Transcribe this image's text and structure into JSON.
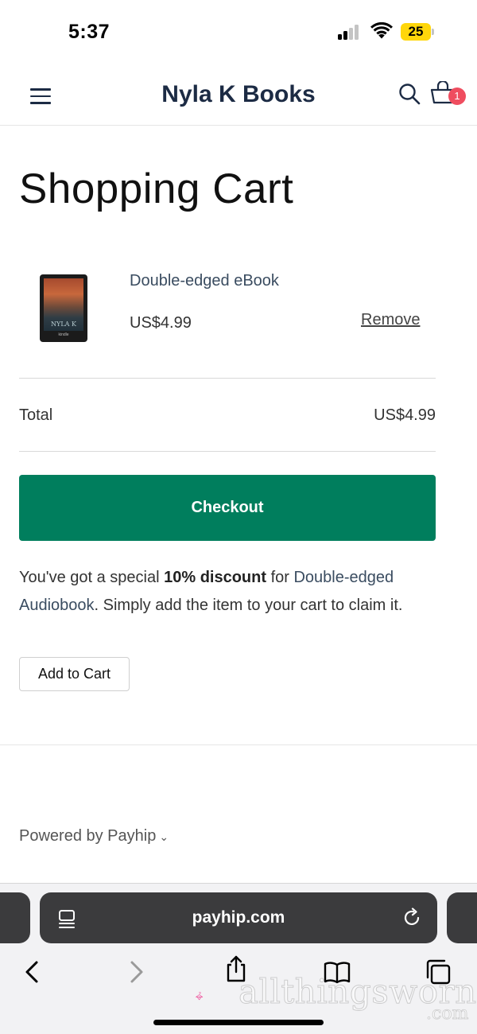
{
  "status_bar": {
    "time": "5:37",
    "battery_level": "25",
    "battery_color": "#ffd60a"
  },
  "header": {
    "site_title": "Nyla K Books",
    "cart_count": "1",
    "menu_icon": "hamburger-menu-icon",
    "search_icon": "search-icon",
    "cart_icon": "shopping-basket-icon",
    "brand_color": "#1c2b44"
  },
  "page": {
    "title": "Shopping Cart"
  },
  "cart": {
    "items": [
      {
        "name": "Double-edged eBook",
        "price": "US$4.99",
        "remove_label": "Remove",
        "thumb_caption": "NYLA K",
        "thumb_device_label": "kindle"
      }
    ],
    "total_label": "Total",
    "total_value": "US$4.99",
    "checkout_label": "Checkout",
    "checkout_color": "#007e5d"
  },
  "promo": {
    "prefix": "You've got a special ",
    "discount": "10% discount",
    "middle": " for ",
    "product_link": "Double-edged Audiobook",
    "suffix": ". Simply add the item to your cart to claim it.",
    "add_button_label": "Add to Cart"
  },
  "footer": {
    "powered_by": "Powered by Payhip",
    "chevron": "⌄"
  },
  "browser": {
    "url": "payhip.com",
    "reader_icon": "reader-mode-icon",
    "reload_icon": "reload-icon",
    "toolbar_icons": [
      "back-icon",
      "forward-icon",
      "share-icon",
      "bookmarks-icon",
      "tabs-icon"
    ]
  },
  "watermark": {
    "text": "allthingsworn",
    "suffix": ".com",
    "color": "#ee3d8f"
  }
}
